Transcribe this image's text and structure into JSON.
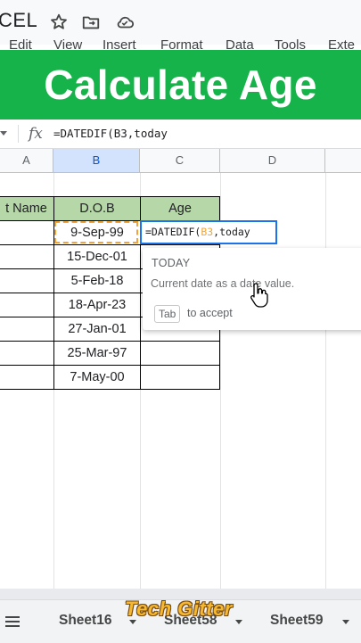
{
  "app": {
    "title": "CEL",
    "menu": [
      "Edit",
      "View",
      "Insert",
      "Format",
      "Data",
      "Tools",
      "Exte"
    ]
  },
  "banner": {
    "text": "Calculate Age"
  },
  "formula_bar": {
    "fx": "fx",
    "text": "=DATEDIF(B3,today"
  },
  "columns": [
    "A",
    "B",
    "C",
    "D"
  ],
  "table": {
    "headers": [
      "t Name",
      "D.O.B",
      "Age"
    ],
    "dob": [
      "9-Sep-99",
      "15-Dec-01",
      "5-Feb-18",
      "18-Apr-23",
      "27-Jan-01",
      "25-Mar-97",
      "7-May-00"
    ]
  },
  "edit_cell": {
    "prefix": "=DATEDIF(",
    "ref": "B3",
    "suffix": ",today"
  },
  "autocomplete": {
    "title": "TODAY",
    "description": "Current date as a date value.",
    "key": "Tab",
    "key_hint": "to accept"
  },
  "sheets": [
    "Sheet16",
    "Sheet58",
    "Sheet59"
  ],
  "watermark": "Tech Gitter",
  "colors": {
    "banner": "#16b34a",
    "header_fill": "#b6d7a8",
    "active_border": "#1a73e8",
    "ref_color": "#f0a733"
  }
}
